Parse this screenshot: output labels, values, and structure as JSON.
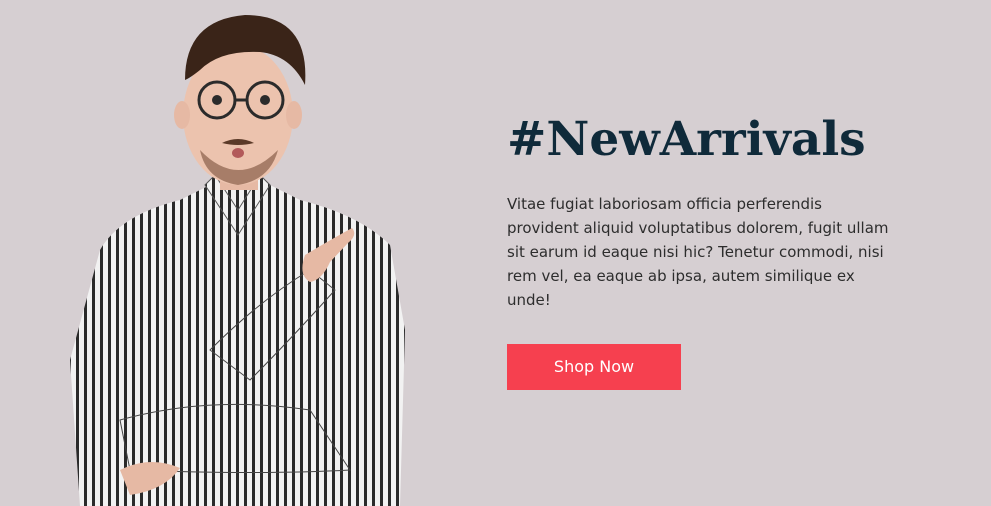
{
  "hero": {
    "headline": "#NewArrivals",
    "description": "Vitae fugiat laboriosam officia perferendis provident aliquid voluptatibus dolorem, fugit ullam sit earum id eaque nisi hic? Tenetur commodi, nisi rem vel, ea eaque ab ipsa, autem similique ex unde!",
    "cta_label": "Shop Now"
  },
  "colors": {
    "background": "#d6cfd2",
    "headline": "#0f2a3a",
    "text": "#2d2d2d",
    "button": "#f6404f",
    "button_text": "#ffffff"
  },
  "image": {
    "subject": "man-in-striped-shirt-pointing-icon"
  }
}
